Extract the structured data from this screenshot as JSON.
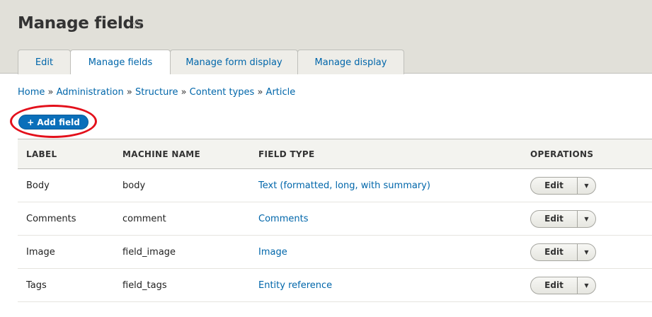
{
  "page": {
    "title": "Manage fields",
    "star_icon": "star-outline-icon"
  },
  "tabs": [
    {
      "label": "Edit"
    },
    {
      "label": "Manage fields",
      "active": true
    },
    {
      "label": "Manage form display"
    },
    {
      "label": "Manage display"
    }
  ],
  "breadcrumb": [
    "Home",
    "Administration",
    "Structure",
    "Content types",
    "Article"
  ],
  "add_field": {
    "label": "+ Add field",
    "highlight_color": "#e3101b"
  },
  "table": {
    "headers": [
      "LABEL",
      "MACHINE NAME",
      "FIELD TYPE",
      "OPERATIONS"
    ],
    "rows": [
      {
        "label": "Body",
        "machine": "body",
        "type": "Text (formatted, long, with summary)",
        "op": "Edit"
      },
      {
        "label": "Comments",
        "machine": "comment",
        "type": "Comments",
        "op": "Edit"
      },
      {
        "label": "Image",
        "machine": "field_image",
        "type": "Image",
        "op": "Edit"
      },
      {
        "label": "Tags",
        "machine": "field_tags",
        "type": "Entity reference",
        "op": "Edit"
      }
    ]
  }
}
